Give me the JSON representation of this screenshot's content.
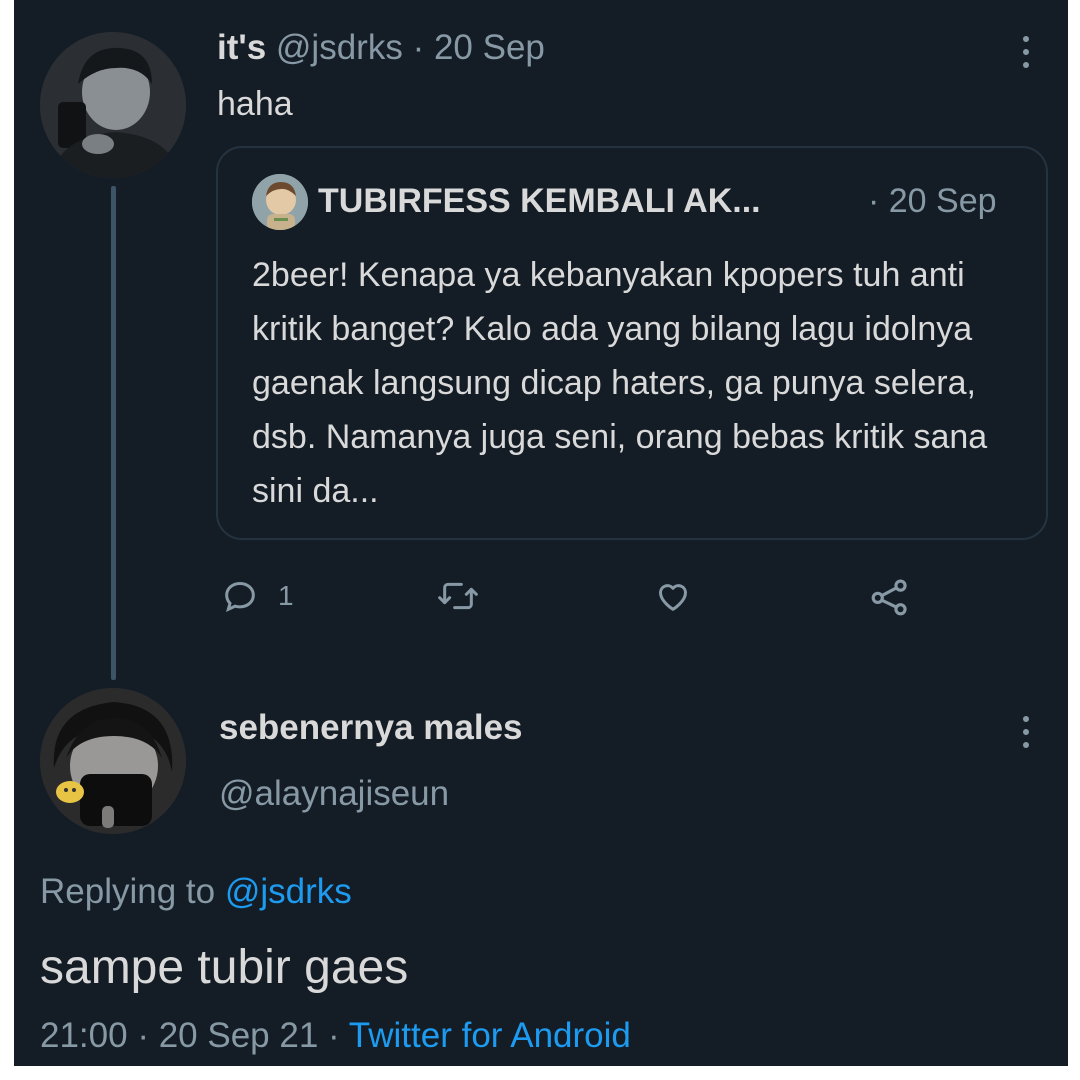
{
  "tweet1": {
    "display_name": "it's",
    "handle": "@jsdrks",
    "sep": "·",
    "date": "20 Sep",
    "text": "haha",
    "quote": {
      "display_name": "TUBIRFESS KEMBALI AK...",
      "date": "· 20 Sep",
      "text": "2beer! Kenapa ya kebanyakan kpopers tuh anti kritik banget? Kalo ada yang bilang lagu idolnya gaenak langsung dicap haters, ga punya selera, dsb. Namanya juga seni, orang bebas kritik sana sini da..."
    },
    "actions": {
      "reply_count": "1"
    }
  },
  "tweet2": {
    "display_name": "sebenernya males",
    "handle": "@alaynajiseun",
    "replying_prefix": "Replying to",
    "replying_to": "@jsdrks",
    "text": "sampe tubir gaes",
    "time": "21:00",
    "sep": "·",
    "date": "20 Sep 21",
    "sep2": "·",
    "source": "Twitter for Android"
  },
  "colors": {
    "background": "#141d26",
    "primary_text": "#d9d9d9",
    "secondary_text": "#8899a6",
    "link": "#1d9bf0",
    "border": "#253341"
  }
}
